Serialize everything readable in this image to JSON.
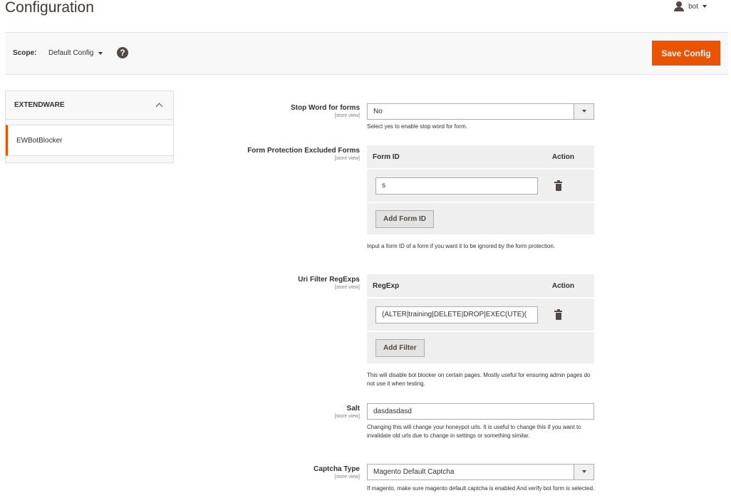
{
  "header": {
    "title": "Configuration",
    "user": "bot"
  },
  "scope_bar": {
    "label": "Scope:",
    "value": "Default Config",
    "help": "?",
    "save_label": "Save Config"
  },
  "sidebar": {
    "section": "EXTENDWARE",
    "items": [
      {
        "label": "EWBotBlocker"
      }
    ]
  },
  "fields": {
    "stop_word": {
      "label": "Stop Word for forms",
      "scope": "[store view]",
      "value": "No",
      "note": "Select yes to enable stop word for form."
    },
    "form_protection": {
      "label": "Form Protection Excluded Forms",
      "scope": "[store view]",
      "col_id": "Form ID",
      "col_action": "Action",
      "rows": [
        {
          "value": "s"
        }
      ],
      "add_label": "Add Form ID",
      "note": "Input a form ID of a form if you want it to be ignored by the form protection."
    },
    "uri_filter": {
      "label": "Uri Filter RegExps",
      "scope": "[store view]",
      "col_id": "RegExp",
      "col_action": "Action",
      "rows": [
        {
          "value": "(ALTER|training|DELETE|DROP|EXEC(UTE)("
        }
      ],
      "add_label": "Add Filter",
      "note": "This will disable bot blocker on certain pages. Mostly useful for ensuring admin pages do not use it when testing."
    },
    "salt": {
      "label": "Salt",
      "scope": "[store view]",
      "value": "dasdasdasd",
      "note": "Changing this will change your honeypot urls. It is useful to change this if you want to invalidate old urls due to change in settings or something similar."
    },
    "captcha": {
      "label": "Captcha Type",
      "scope": "[store view]",
      "value": "Magento Default Captcha",
      "note": "If magento, make sure magento default captcha is enabled And verify bot form is selected."
    }
  },
  "colors": {
    "accent": "#eb5202",
    "text": "#303030",
    "panel": "#efefef"
  }
}
